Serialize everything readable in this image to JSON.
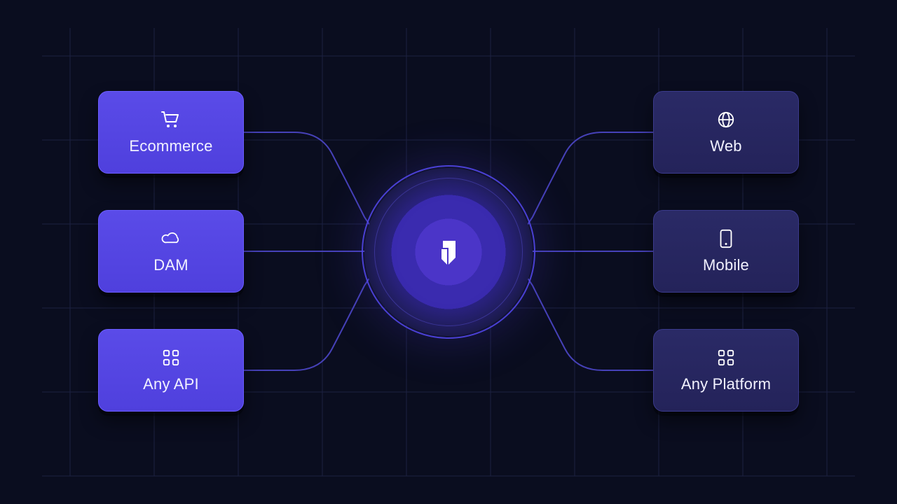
{
  "hub": {
    "logo_name": "brand-logo"
  },
  "left": [
    {
      "id": "ecommerce",
      "label": "Ecommerce",
      "icon": "cart-icon",
      "style": "bright"
    },
    {
      "id": "dam",
      "label": "DAM",
      "icon": "cloud-icon",
      "style": "bright"
    },
    {
      "id": "any-api",
      "label": "Any API",
      "icon": "grid-icon",
      "style": "bright"
    }
  ],
  "right": [
    {
      "id": "web",
      "label": "Web",
      "icon": "globe-icon",
      "style": "dim"
    },
    {
      "id": "mobile",
      "label": "Mobile",
      "icon": "mobile-icon",
      "style": "dim"
    },
    {
      "id": "any-platform",
      "label": "Any Platform",
      "icon": "grid-icon",
      "style": "dim"
    }
  ],
  "colors": {
    "grid": "#1c2142",
    "connector": "#4641b8",
    "hub_ring": "#5146e5"
  }
}
